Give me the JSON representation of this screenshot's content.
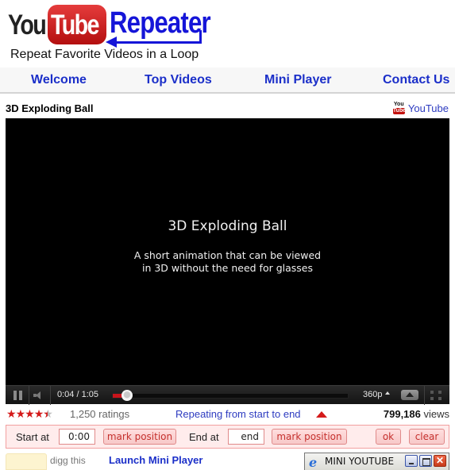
{
  "logo": {
    "you": "You",
    "tube": "Tube",
    "repeater": "Repeater",
    "tagline": "Repeat Favorite Videos in a Loop"
  },
  "nav": {
    "items": [
      {
        "label": "Welcome"
      },
      {
        "label": "Top Videos"
      },
      {
        "label": "Mini Player"
      },
      {
        "label": "Contact Us"
      }
    ]
  },
  "video": {
    "title": "3D Exploding Ball",
    "source_link": "YouTube",
    "source_icon_top": "You",
    "source_icon_bottom": "Tube",
    "frame_title": "3D Exploding Ball",
    "frame_subtitle_line1": "A short animation that can be viewed",
    "frame_subtitle_line2": "in 3D without the need for glasses"
  },
  "player": {
    "time": "0:04 / 1:05",
    "progress_fraction": 0.06,
    "quality": "360p",
    "icons": [
      "pause-icon",
      "volume-icon",
      "popout-icon",
      "fullscreen-icon"
    ]
  },
  "info": {
    "rating_stars": 4.5,
    "ratings_text": "1,250 ratings",
    "repeating_text": "Repeating from start to end",
    "views_count": "799,186",
    "views_label": " views"
  },
  "repeat": {
    "start_label": "Start at",
    "start_value": "0:00",
    "mark_start_label": "mark position",
    "end_label": "End at",
    "end_value": "end",
    "mark_end_label": "mark position",
    "ok_label": "ok",
    "clear_label": "clear"
  },
  "bottom": {
    "digg_text": "digg this",
    "launch_label": "Launch Mini Player",
    "mini_window_title": "MINI YOUTUBE"
  },
  "colors": {
    "link_blue": "#1b2fc9",
    "accent_red": "#d41a1a",
    "repeat_bg": "#ffecec"
  }
}
